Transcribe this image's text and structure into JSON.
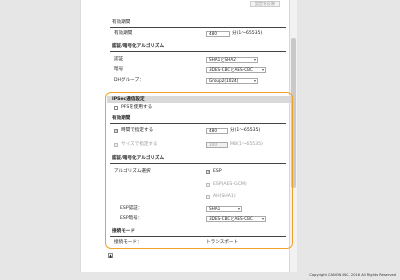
{
  "top_button": "設定を反映",
  "key_lifetime": {
    "section": "有効期間",
    "label": "有効期間",
    "value": "480",
    "unit": "分(1〜65535)"
  },
  "auth_enc_top": {
    "section": "認証/暗号化アルゴリズム",
    "auth_label": "認証",
    "auth_value": "SHA1とSHA2",
    "enc_label": "暗号",
    "enc_value": "3DES-CBCとAES-CBC",
    "dh_label": "DHグループ：",
    "dh_value": "Group2(1024)"
  },
  "ipsec_settings": {
    "header": "IPSec通信設定",
    "pfs_label": "PFSを使用する",
    "pfs_checked": false,
    "validity_section": "有効期間",
    "time_label": "時間で指定する",
    "time_checked": true,
    "time_value": "480",
    "time_unit": "分(1〜65535)",
    "size_label": "サイズで指定する",
    "size_checked": false,
    "size_value": "100",
    "size_unit": "MB(1〜65535)",
    "auth_enc_section": "認証/暗号化アルゴリズム",
    "algo_label": "アルゴリズム選択",
    "opt_esp": "ESP",
    "opt_esp_checked": true,
    "opt_esp_gcm": "ESP(AES-GCM)",
    "opt_esp_gcm_checked": false,
    "opt_ah": "AH(SHA1)",
    "opt_ah_checked": false,
    "esp_auth_label": "ESP認証：",
    "esp_auth_value": "SHA1",
    "esp_enc_label": "ESP暗号：",
    "esp_enc_value": "3DES-CBCとAES-CBC",
    "mode_section": "接続モード",
    "mode_label": "接続モード：",
    "mode_value": "トランスポート"
  },
  "footer": {
    "copyright": "Copyright CANON INC. 2016 All Rights Reserved"
  }
}
